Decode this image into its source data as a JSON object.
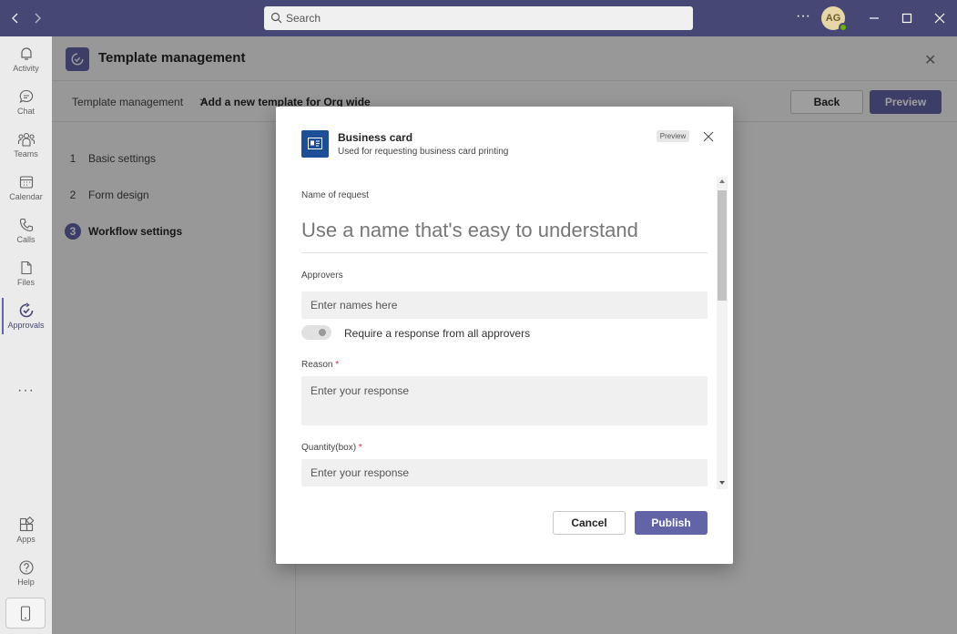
{
  "titlebar": {
    "search_placeholder": "Search",
    "more_glyph": "···",
    "avatar_initials": "AG",
    "presence_color": "#6bb700",
    "background_color": "#464775"
  },
  "rail": {
    "items": [
      {
        "label": "Activity",
        "icon": "bell-icon"
      },
      {
        "label": "Chat",
        "icon": "chat-icon"
      },
      {
        "label": "Teams",
        "icon": "teams-icon"
      },
      {
        "label": "Calendar",
        "icon": "calendar-icon"
      },
      {
        "label": "Calls",
        "icon": "phone-icon"
      },
      {
        "label": "Files",
        "icon": "file-icon"
      },
      {
        "label": "Approvals",
        "icon": "approvals-icon",
        "active": true
      }
    ],
    "more_glyph": "···",
    "bottom_items": [
      {
        "label": "Apps",
        "icon": "apps-icon"
      },
      {
        "label": "Help",
        "icon": "help-icon"
      }
    ]
  },
  "page": {
    "title": "Template management",
    "breadcrumb": {
      "root": "Template management",
      "separator": ">",
      "current": "Add a new template for Org wide"
    },
    "back_label": "Back",
    "preview_label": "Preview",
    "close_glyph": "✕",
    "steps": [
      {
        "num": "1",
        "label": "Basic settings"
      },
      {
        "num": "2",
        "label": "Form design"
      },
      {
        "num": "3",
        "label": "Workflow settings",
        "active": true
      }
    ]
  },
  "dialog": {
    "title": "Business card",
    "subtitle": "Used for requesting business card printing",
    "badge": "Preview",
    "fields": {
      "name_label": "Name of request",
      "name_placeholder": "Use a name that's easy to understand",
      "approvers_label": "Approvers",
      "approvers_placeholder": "Enter names here",
      "toggle_label": "Require a response from all approvers",
      "toggle_on": false,
      "reason_label": "Reason",
      "reason_placeholder": "Enter your response",
      "quantity_label": "Quantity(box)",
      "quantity_placeholder": "Enter your response",
      "required_mark": "*"
    },
    "cancel_label": "Cancel",
    "publish_label": "Publish",
    "accent_color": "#6264a7",
    "card_icon_color": "#1e4f96"
  }
}
